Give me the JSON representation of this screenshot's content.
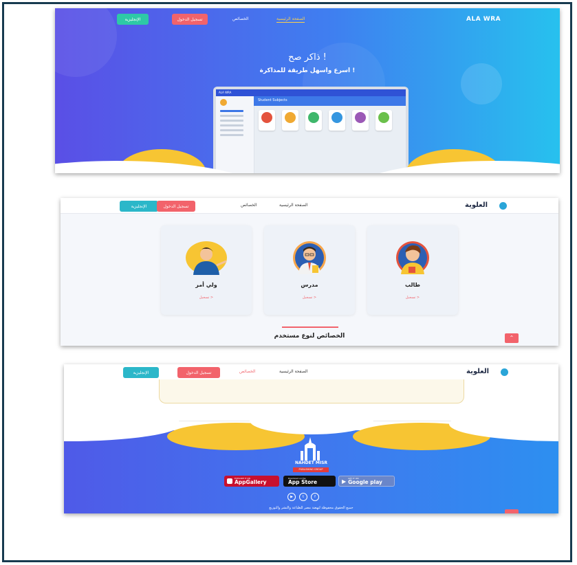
{
  "hero": {
    "logo": "ALA WRA",
    "nav": {
      "home": "الصفحة الرئيسية",
      "features": "الخصائص",
      "register": "تسجيل الدخول",
      "english": "الإنجليزية"
    },
    "title": "ذاكر صح !",
    "subtitle": "اسرع واسهل طريقة للمذاكرة !",
    "laptop": {
      "app_logo": "ALA WRA",
      "section_title": "Student Subjects",
      "subject_colors": [
        "#e4533d",
        "#f0a932",
        "#3fb76b",
        "#3596e0",
        "#9b59b6",
        "#6bc04b"
      ]
    }
  },
  "users": {
    "logo": "العلوية",
    "nav": {
      "home": "الصفحة الرئيسية",
      "features": "الخصائص",
      "register": "تسجيل الدخول",
      "english": "الإنجليزية"
    },
    "cards": [
      {
        "title": "طالب",
        "action": "تسجيل >",
        "avatar": "student-avatar"
      },
      {
        "title": "مدرس",
        "action": "تسجيل >",
        "avatar": "teacher-avatar"
      },
      {
        "title": "ولي أمر",
        "action": "تسجيل >",
        "avatar": "parent-avatar"
      }
    ],
    "section_title": "الخصائص لنوع مستخدم",
    "scroll_up_icon": "chevron-up-icon"
  },
  "footer": {
    "logo": "العلوية",
    "nav": {
      "home": "الصفحة الرئيسية",
      "features": "الخصائص",
      "register": "تسجيل الدخول",
      "english": "الإنجليزية"
    },
    "brand": "NAHDET MISR",
    "brand_tag": "PUBLISHING GROUP",
    "stores": [
      {
        "small": "EXPLORE IT ON",
        "big": "AppGallery",
        "color": "#c8102e"
      },
      {
        "small": "Download on the",
        "big": "App Store",
        "color": "#111111"
      },
      {
        "small": "GET IT ON",
        "big": "Google play",
        "color": "#6a86c9"
      }
    ],
    "social_icons": [
      "youtube-icon",
      "twitter-icon",
      "facebook-icon"
    ],
    "copyright": "جميع الحقوق محفوظة لنهضة مصر للطباعة والنشر والتوزيع"
  },
  "colors": {
    "accent": "#f2636b",
    "teal": "#2bb7c9",
    "green": "#2ec9a6",
    "yellow": "#f7c533",
    "blue": "#3d7cef",
    "frame": "#173a4f"
  }
}
